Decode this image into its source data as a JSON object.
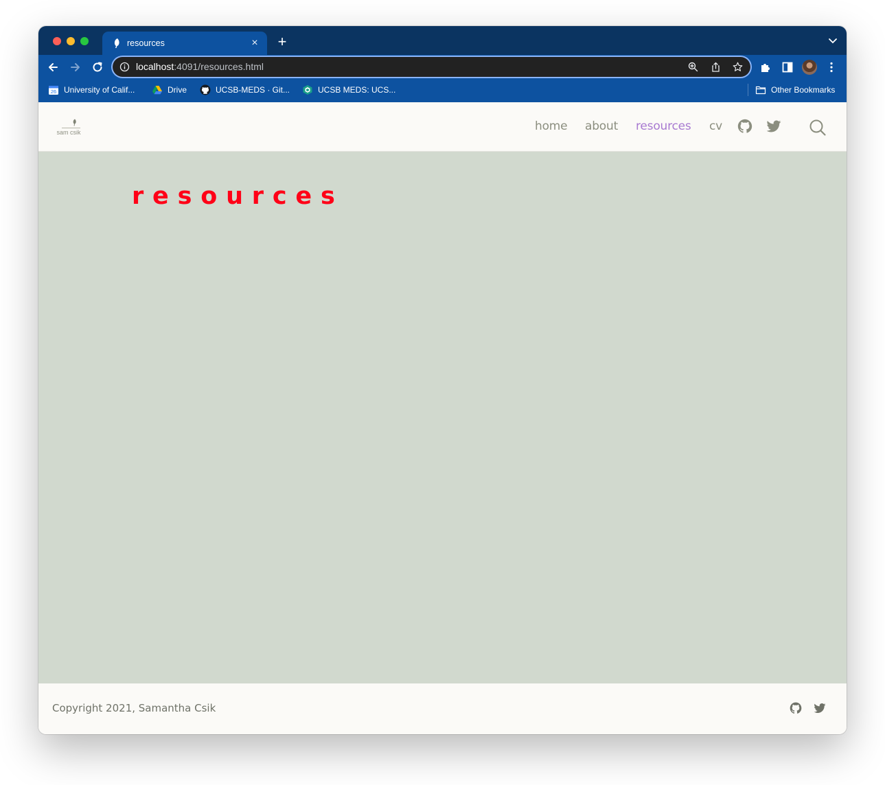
{
  "browser": {
    "tab": {
      "title": "resources",
      "favicon": "leaf-icon",
      "close_glyph": "×"
    },
    "new_tab_glyph": "+",
    "toolbar": {
      "back": "arrow-left-icon",
      "forward": "arrow-right-icon",
      "reload": "reload-icon"
    },
    "address_bar": {
      "host": "localhost",
      "path": ":4091/resources.html"
    },
    "bookmarks": [
      {
        "label": "University of Calif...",
        "icon": "calendar-icon"
      },
      {
        "label": "Drive",
        "icon": "google-drive-icon"
      },
      {
        "label": "UCSB-MEDS · Git...",
        "icon": "github-icon"
      },
      {
        "label": "UCSB MEDS: UCS...",
        "icon": "ucsb-meds-icon"
      }
    ],
    "other_bookmarks": "Other Bookmarks",
    "calendar_badge": "26"
  },
  "site": {
    "brand": "sam csik",
    "nav": [
      {
        "label": "home",
        "active": false
      },
      {
        "label": "about",
        "active": false
      },
      {
        "label": "resources",
        "active": true
      },
      {
        "label": "cv",
        "active": false
      }
    ],
    "nav_icons": [
      "github-icon",
      "twitter-icon"
    ],
    "search": "search-icon",
    "page_title": "resources",
    "footer": {
      "copyright": "Copyright 2021, Samantha Csik",
      "icons": [
        "github-icon",
        "twitter-icon"
      ]
    }
  },
  "colors": {
    "titlebar": "#0b3461",
    "chrome": "#0d52a0",
    "nav_active": "#a87ad1",
    "nav_text": "#8b8e7f",
    "content_bg": "#d1d9ce",
    "page_title": "#ff0017"
  }
}
